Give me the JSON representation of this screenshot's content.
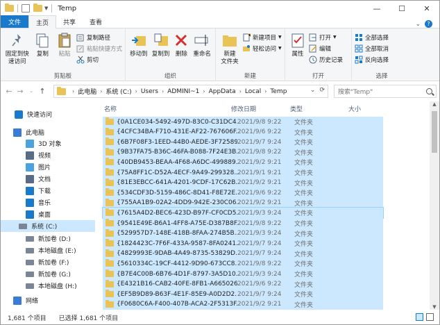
{
  "title": "Temp",
  "tabs": {
    "file": "文件",
    "home": "主页",
    "share": "共享",
    "view": "查看"
  },
  "ribbon": {
    "clipboard": {
      "label": "剪贴板",
      "pin": "固定到快\n速访问",
      "copy": "复制",
      "paste": "粘贴",
      "copy_path": "复制路径",
      "paste_shortcut": "粘贴快捷方式",
      "cut": "剪切"
    },
    "organize": {
      "label": "组织",
      "move_to": "移动到",
      "copy_to": "复制到",
      "delete": "删除",
      "rename": "重命名"
    },
    "new": {
      "label": "新建",
      "new_folder": "新建\n文件夹",
      "new_item": "新建项目",
      "easy_access": "轻松访问"
    },
    "open": {
      "label": "打开",
      "properties": "属性",
      "open": "打开",
      "edit": "编辑",
      "history": "历史记录"
    },
    "select": {
      "label": "选择",
      "select_all": "全部选择",
      "select_none": "全部取消",
      "invert": "反向选择"
    }
  },
  "address": {
    "crumbs": [
      "此电脑",
      "系统 (C:)",
      "Users",
      "ADMINI~1",
      "AppData",
      "Local",
      "Temp"
    ],
    "search_placeholder": "搜索\"Temp\""
  },
  "nav": [
    {
      "label": "快速访问",
      "icon": "star-icon"
    },
    {
      "label": "此电脑",
      "icon": "computer-icon"
    },
    {
      "label": "3D 对象",
      "icon": "cube-icon"
    },
    {
      "label": "视频",
      "icon": "video-icon"
    },
    {
      "label": "图片",
      "icon": "picture-icon"
    },
    {
      "label": "文档",
      "icon": "document-icon"
    },
    {
      "label": "下载",
      "icon": "download-icon"
    },
    {
      "label": "音乐",
      "icon": "music-icon"
    },
    {
      "label": "桌面",
      "icon": "desktop-icon"
    },
    {
      "label": "系统 (C:)",
      "icon": "drive-icon"
    },
    {
      "label": "新加卷 (D:)",
      "icon": "drive-icon"
    },
    {
      "label": "本地磁盘 (E:)",
      "icon": "drive-icon"
    },
    {
      "label": "新加卷 (F:)",
      "icon": "drive-icon"
    },
    {
      "label": "新加卷 (G:)",
      "icon": "drive-icon"
    },
    {
      "label": "本地磁盘 (H:)",
      "icon": "drive-icon"
    },
    {
      "label": "网络",
      "icon": "network-icon"
    }
  ],
  "columns": {
    "name": "名称",
    "date": "修改日期",
    "type": "类型",
    "size": "大小"
  },
  "files": [
    {
      "name": "{0A1CE034-5492-497D-83C0-C31DC4...",
      "date": "2021/9/8 9:22",
      "type": "文件夹"
    },
    {
      "name": "{4CFC34BA-F710-431E-AF22-767606F...",
      "date": "2021/9/6 9:22",
      "type": "文件夹"
    },
    {
      "name": "{6B7F08F3-1EED-44B0-AEDE-3F72589...",
      "date": "2021/9/7 9:24",
      "type": "文件夹"
    },
    {
      "name": "{9B37FA75-B36C-46FA-B088-7F24E3B...",
      "date": "2021/9/8 9:22",
      "type": "文件夹"
    },
    {
      "name": "{40DB9453-BEAA-4F68-A6DC-499889...",
      "date": "2021/9/2 9:21",
      "type": "文件夹"
    },
    {
      "name": "{75A8FF1C-D52A-4ECF-9A49-299328...",
      "date": "2021/9/1 9:21",
      "type": "文件夹"
    },
    {
      "name": "{81E3EBCC-641A-4201-9CDF-17C62B...",
      "date": "2021/9/2 9:21",
      "type": "文件夹"
    },
    {
      "name": "{534CDF3D-5159-486C-8D41-F8E72E...",
      "date": "2021/9/6 9:22",
      "type": "文件夹"
    },
    {
      "name": "{755AA1B9-02A2-4DD9-942E-230C06...",
      "date": "2021/9/2 9:21",
      "type": "文件夹"
    },
    {
      "name": "{7615A4D2-BEC6-423D-B97F-CF0CD5...",
      "date": "2021/9/3 9:24",
      "type": "文件夹"
    },
    {
      "name": "{9541E49E-B6A1-4FF8-A75E-D387B8F...",
      "date": "2021/9/8 9:22",
      "type": "文件夹"
    },
    {
      "name": "{529957D7-148E-418B-8FAA-274B5B...",
      "date": "2021/9/3 9:24",
      "type": "文件夹"
    },
    {
      "name": "{1824423C-7F6F-433A-9587-8FA0241...",
      "date": "2021/9/7 9:24",
      "type": "文件夹"
    },
    {
      "name": "{4829993E-9DAB-4A49-8735-53829D...",
      "date": "2021/9/7 9:24",
      "type": "文件夹"
    },
    {
      "name": "{5610334C-19CF-4412-9D90-673CC8...",
      "date": "2021/9/8 9:22",
      "type": "文件夹"
    },
    {
      "name": "{B7E4C00B-6B76-4D1F-8797-3A5D10...",
      "date": "2021/9/3 9:24",
      "type": "文件夹"
    },
    {
      "name": "{E4321B16-CAB2-40FE-8FB1-A665026...",
      "date": "2021/9/6 9:22",
      "type": "文件夹"
    },
    {
      "name": "{EF5B9D89-B63F-4E1F-85E9-A0D2D2...",
      "date": "2021/9/7 9:24",
      "type": "文件夹"
    },
    {
      "name": "{F0680C6A-F400-407B-ACA2-2F5313F...",
      "date": "2021/9/2 9:21",
      "type": "文件夹"
    }
  ],
  "status": {
    "count": "1,681 个项目",
    "selected": "已选择 1,681 个项目"
  },
  "colors": {
    "accent": "#1979ca",
    "selection": "#cce8ff",
    "folder": "#e9c355"
  }
}
